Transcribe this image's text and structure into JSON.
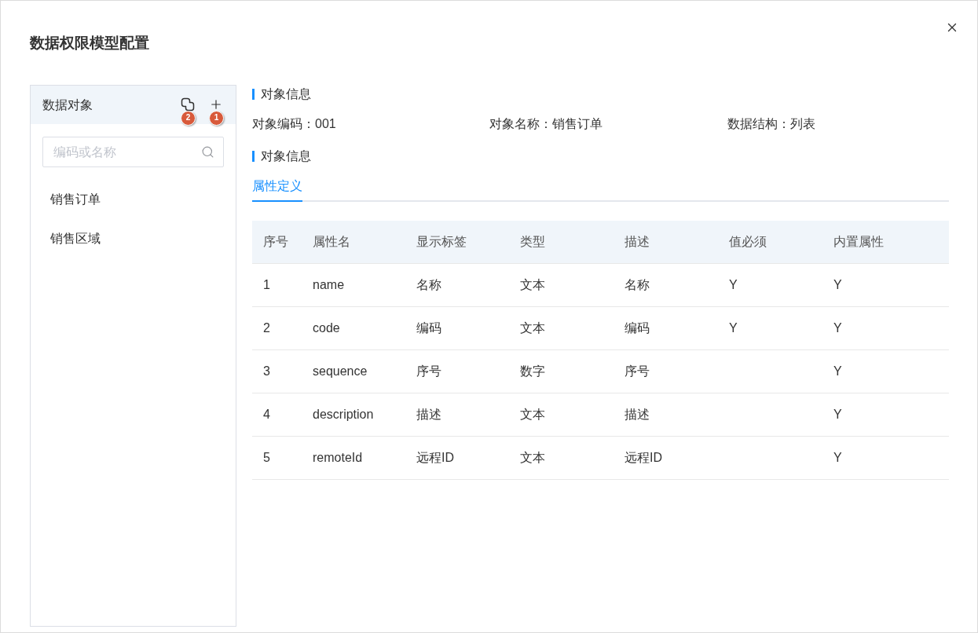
{
  "dialog": {
    "title": "数据权限模型配置"
  },
  "sidebar": {
    "title": "数据对象",
    "actions": [
      {
        "kind": "link",
        "marker": "2"
      },
      {
        "kind": "add",
        "marker": "1"
      }
    ],
    "search": {
      "placeholder": "编码或名称"
    },
    "items": [
      {
        "label": "销售订单",
        "selected": false
      },
      {
        "label": "销售区域",
        "selected": false
      }
    ]
  },
  "detail": {
    "sections": [
      {
        "title": "对象信息",
        "fields": [
          {
            "label": "对象编码：",
            "value": "001"
          },
          {
            "label": "对象名称：",
            "value": "销售订单"
          },
          {
            "label": "数据结构：",
            "value": "列表"
          }
        ]
      },
      {
        "title": "对象信息"
      }
    ],
    "tabs": [
      {
        "label": "属性定义",
        "selected": true
      }
    ],
    "table": {
      "columns": [
        "序号",
        "属性名",
        "显示标签",
        "类型",
        "描述",
        "值必须",
        "内置属性"
      ],
      "rows": [
        {
          "index": "1",
          "attribute": "name",
          "display_label": "名称",
          "type": "文本",
          "description": "名称",
          "required": "Y",
          "built_in": "Y"
        },
        {
          "index": "2",
          "attribute": "code",
          "display_label": "编码",
          "type": "文本",
          "description": "编码",
          "required": "Y",
          "built_in": "Y"
        },
        {
          "index": "3",
          "attribute": "sequence",
          "display_label": "序号",
          "type": "数字",
          "description": "序号",
          "built_in": "Y"
        },
        {
          "index": "4",
          "attribute": "description",
          "display_label": "描述",
          "type": "文本",
          "description": "描述",
          "built_in": "Y"
        },
        {
          "index": "5",
          "attribute": "remoteId",
          "display_label": "远程ID",
          "type": "文本",
          "description": "远程ID",
          "built_in": "Y"
        }
      ]
    }
  }
}
